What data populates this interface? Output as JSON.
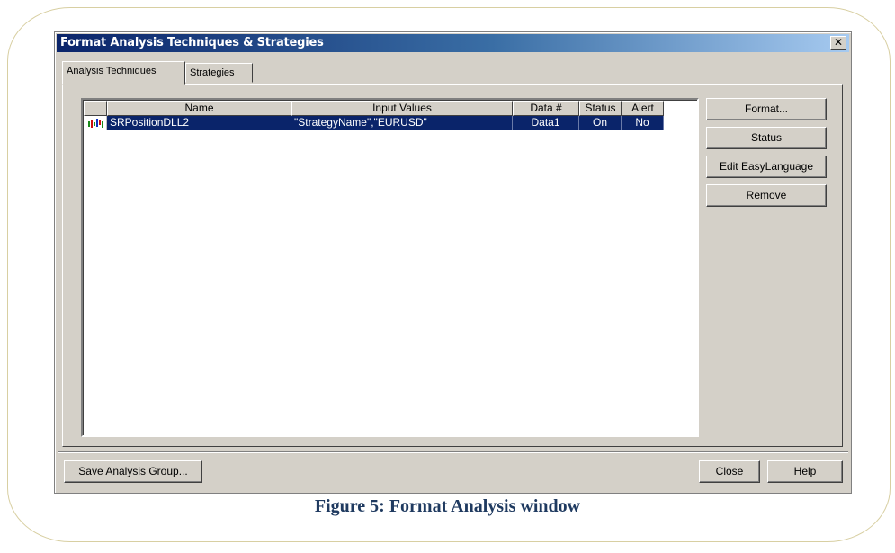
{
  "dialog": {
    "title": "Format Analysis Techniques & Strategies",
    "close_glyph": "✕",
    "close_icon": "close-icon"
  },
  "tabs": [
    {
      "label": "Analysis Techniques",
      "active": true
    },
    {
      "label": "Strategies",
      "active": false
    }
  ],
  "table": {
    "columns": [
      "Name",
      "Input Values",
      "Data #",
      "Status",
      "Alert"
    ],
    "rows": [
      {
        "icon": "chart-bars-icon",
        "name": "SRPositionDLL2",
        "input_values": "\"StrategyName\",\"EURUSD\"",
        "data": "Data1",
        "status": "On",
        "alert": "No",
        "selected": true
      }
    ]
  },
  "side_buttons": {
    "format": "Format...",
    "status": "Status",
    "edit": "Edit EasyLanguage",
    "remove": "Remove"
  },
  "bottom_buttons": {
    "save": "Save Analysis Group...",
    "close": "Close",
    "help": "Help"
  },
  "caption": "Figure 5: Format Analysis window",
  "colors": {
    "selection": "#0a246a",
    "dialog_bg": "#d4d0c8",
    "caption": "#1f3a60"
  }
}
